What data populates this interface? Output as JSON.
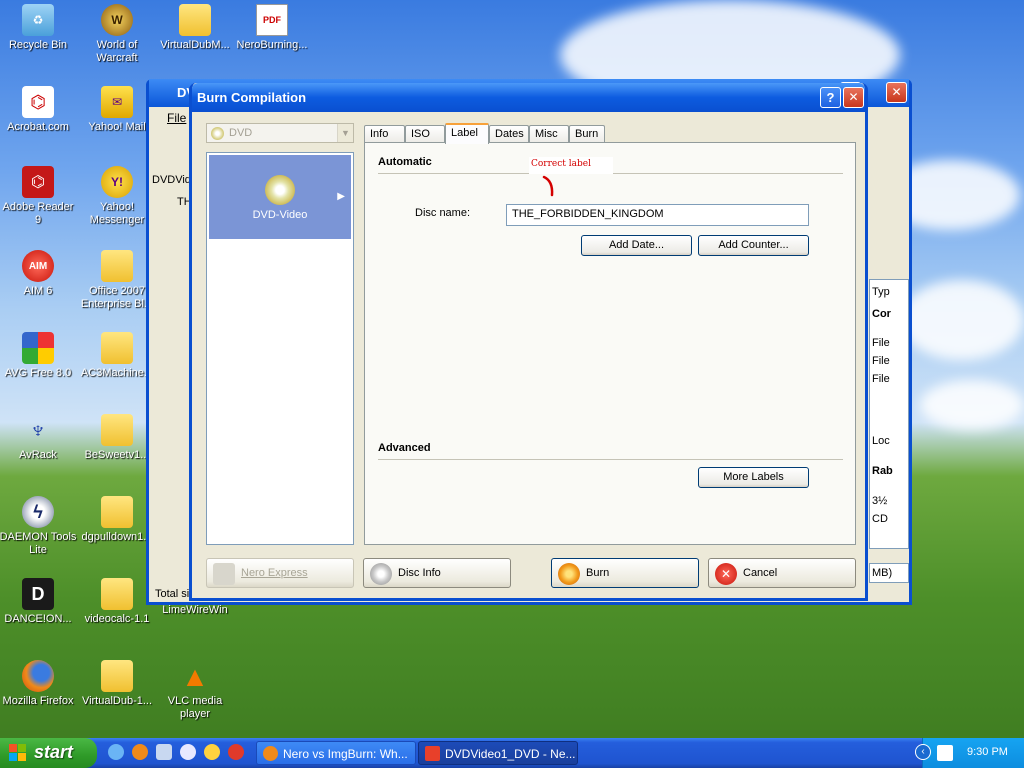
{
  "desktop": {
    "icons": [
      {
        "label": "Recycle Bin"
      },
      {
        "label": "World of Warcraft"
      },
      {
        "label": "VirtualDubM..."
      },
      {
        "label": "NeroBurning..."
      },
      {
        "label": "Acrobat.com"
      },
      {
        "label": "Yahoo! Mail"
      },
      {
        "label": "Adobe Reader 9"
      },
      {
        "label": "Yahoo! Messenger"
      },
      {
        "label": "AIM 6"
      },
      {
        "label": "Office 2007 Enterprise Bl..."
      },
      {
        "label": "AVG Free 8.0"
      },
      {
        "label": "AC3Machine..."
      },
      {
        "label": "AvRack"
      },
      {
        "label": "BeSweetv1..."
      },
      {
        "label": "DAEMON Tools Lite"
      },
      {
        "label": "dgpulldown1..."
      },
      {
        "label": "DANCE!ON..."
      },
      {
        "label": "videocalc-1.1"
      },
      {
        "label": "LimeWireWin"
      },
      {
        "label": "Mozilla Firefox"
      },
      {
        "label": "VirtualDub-1..."
      },
      {
        "label": "VLC media player"
      }
    ]
  },
  "bg_window": {
    "title": "DVD",
    "menu_file": "File",
    "tree_header": "DVDVide",
    "tree_item": "THE",
    "right_col": [
      "Typ",
      "Cor",
      "File",
      "File",
      "File",
      "Loc",
      "Rab",
      "3½",
      "CD"
    ],
    "status_total": "Total siz",
    "size_unit": "MB)"
  },
  "dialog": {
    "title": "Burn Compilation",
    "help_label": "?",
    "close_label": "✕",
    "disc_type": "DVD",
    "compilation_type": "DVD-Video",
    "tabs": [
      {
        "label": "Info"
      },
      {
        "label": "ISO"
      },
      {
        "label": "Label"
      },
      {
        "label": "Dates"
      },
      {
        "label": "Misc"
      },
      {
        "label": "Burn"
      }
    ],
    "active_tab": "Label",
    "automatic_header": "Automatic",
    "annotation": "Correct label",
    "disc_name_label": "Disc name:",
    "disc_name_value": "THE_FORBIDDEN_KINGDOM",
    "add_date_label": "Add Date...",
    "add_counter_label": "Add Counter...",
    "advanced_header": "Advanced",
    "more_labels_label": "More Labels",
    "nero_express_label": "Nero Express",
    "disc_info_label": "Disc Info",
    "burn_label": "Burn",
    "cancel_label": "Cancel"
  },
  "taskbar": {
    "start_label": "start",
    "tasks": [
      {
        "label": "Nero vs ImgBurn: Wh..."
      },
      {
        "label": "DVDVideo1_DVD - Ne..."
      }
    ],
    "clock": "9:30 PM"
  },
  "colors": {
    "titlebar_blue": "#0a4fd0",
    "selection_blue": "#7b95d6",
    "close_red": "#e0452c",
    "tab_highlight": "#f7a13a",
    "annotation_red": "#d40000"
  }
}
